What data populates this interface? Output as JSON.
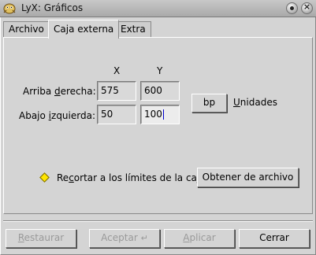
{
  "window": {
    "title": "LyX: Gráficos"
  },
  "tabs": [
    {
      "label": "Archivo",
      "active": false
    },
    {
      "label": "Caja externa",
      "active": true
    },
    {
      "label": "Extra",
      "active": false
    }
  ],
  "bbox": {
    "col_x": "X",
    "col_y": "Y",
    "upper_right": {
      "label_pre": "Arriba ",
      "label_u": "d",
      "label_post": "erecha:",
      "x": "575",
      "y": "600"
    },
    "lower_left": {
      "label_pre": "Abajo ",
      "label_u": "i",
      "label_post": "zquierda:",
      "x": "50",
      "y": "100"
    },
    "unit_button": "bp",
    "units_label_u": "U",
    "units_label_post": "nidades"
  },
  "clip": {
    "label_pre": "Re",
    "label_u": "c",
    "label_post": "ortar a los límites de la caja",
    "checked": true,
    "check_color": "#ffe500"
  },
  "get_from_file_button": "Obtener de archivo",
  "footer": {
    "restore_u": "R",
    "restore_post": "estaurar",
    "restore_enabled": false,
    "accept": "Aceptar",
    "accept_enabled": false,
    "apply_u": "A",
    "apply_post": "plicar",
    "apply_enabled": false,
    "close": "Cerrar",
    "close_enabled": true
  }
}
